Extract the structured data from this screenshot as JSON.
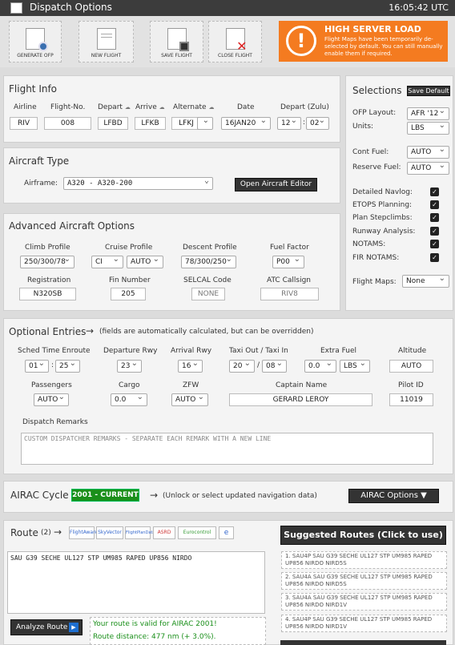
{
  "window": {
    "title": "Dispatch Options",
    "time": "16:05:42 UTC"
  },
  "toolbar": {
    "generate": "GENERATE OFP",
    "new_flight": "NEW FLIGHT",
    "save": "SAVE FLIGHT",
    "close": "CLOSE FLIGHT"
  },
  "warning": {
    "symbol": "!",
    "title": "HIGH SERVER LOAD",
    "message": "Flight Maps have been temporarily de-selected by default. You can still manually enable them if required."
  },
  "flight_info": {
    "title": "Flight Info",
    "labels": {
      "airline": "Airline",
      "flight_no": "Flight-No.",
      "depart": "Depart",
      "arrive": "Arrive",
      "alternate": "Alternate",
      "date": "Date",
      "depart_zulu": "Depart (Zulu)"
    },
    "airline": "RIV",
    "flight_no": "008",
    "depart": "LFBD",
    "arrive": "LFKB",
    "alternate": "LFKJ",
    "date": "16JAN20",
    "dep_hour": "12",
    "dep_min": "02",
    "colon": ":"
  },
  "aircraft": {
    "title": "Aircraft Type",
    "airframe_label": "Airframe:",
    "airframe": "A320 - A320-200",
    "editor_button": "Open Aircraft Editor"
  },
  "advanced": {
    "title": "Advanced Aircraft Options",
    "labels": {
      "climb": "Climb Profile",
      "cruise": "Cruise Profile",
      "descent": "Descent Profile",
      "fuel_factor": "Fuel Factor",
      "registration": "Registration",
      "fin": "Fin Number",
      "selcal": "SELCAL Code",
      "atc": "ATC Callsign"
    },
    "climb": "250/300/78",
    "cruise_mode": "CI",
    "cruise_level": "AUTO",
    "descent": "78/300/250",
    "fuel_factor": "P00",
    "registration": "N320SB",
    "fin": "205",
    "selcal": "NONE",
    "atc": "RIV8"
  },
  "selections": {
    "title": "Selections",
    "save_default": "Save Default",
    "ofp_layout_label": "OFP Layout:",
    "ofp_layout": "AFR '12",
    "units_label": "Units:",
    "units": "LBS",
    "cont_fuel_label": "Cont Fuel:",
    "cont_fuel": "AUTO",
    "reserve_fuel_label": "Reserve Fuel:",
    "reserve_fuel": "AUTO",
    "checks": [
      {
        "label": "Detailed Navlog:",
        "mark": "✓"
      },
      {
        "label": "ETOPS Planning:",
        "mark": "✓"
      },
      {
        "label": "Plan Stepclimbs:",
        "mark": "✓"
      },
      {
        "label": "Runway Analysis:",
        "mark": "✓"
      },
      {
        "label": "NOTAMS:",
        "mark": "✓"
      },
      {
        "label": "FIR NOTAMS:",
        "mark": "✓"
      }
    ],
    "flight_maps_label": "Flight Maps:",
    "flight_maps": "None"
  },
  "optional": {
    "title": "Optional Entries",
    "arrow": "→",
    "note": "(fields are automatically calculated, but can be overridden)",
    "labels": {
      "sched": "Sched Time Enroute",
      "dep_rwy": "Departure Rwy",
      "arr_rwy": "Arrival Rwy",
      "taxi": "Taxi Out / Taxi In",
      "extra_fuel": "Extra Fuel",
      "altitude": "Altitude",
      "pax": "Passengers",
      "cargo": "Cargo",
      "zfw": "ZFW",
      "captain": "Captain Name",
      "pilot_id": "Pilot ID",
      "remarks": "Dispatch Remarks"
    },
    "sched_h": "01",
    "sched_m": "25",
    "colon": ":",
    "dep_rwy": "23",
    "arr_rwy": "16",
    "taxi_out": "20",
    "slash": "/",
    "taxi_in": "08",
    "extra_fuel": "0.0",
    "extra_unit": "LBS",
    "altitude": "AUTO",
    "pax": "AUTO",
    "cargo": "0.0",
    "zfw": "AUTO",
    "captain": "GERARD LEROY",
    "pilot_id": "11019",
    "remarks_placeholder": "CUSTOM DISPATCHER REMARKS - SEPARATE EACH REMARK WITH A NEW LINE"
  },
  "airac": {
    "title": "AIRAC Cycle",
    "badge": "2001 - CURRENT",
    "arrow": "→",
    "note": "(Unlock or select updated navigation data)",
    "button": "AIRAC Options ▼"
  },
  "route": {
    "title": "Route",
    "count": "(2)",
    "arrow": "→",
    "providers": [
      "FlightAware",
      "SkyVector",
      "FlightPlanDatabase",
      "ASRD",
      "Eurocontrol",
      "e"
    ],
    "text": "SAU G39 SECHE UL127 STP UM985 RAPED UP856 NIRDO",
    "analyze": "Analyze Route",
    "analyze_icon": "▶",
    "valid": "Your route is valid for AIRAC 2001!",
    "distance": "Route distance: 477 nm (+ 3.0%).",
    "suggested_title": "Suggested Routes (Click to use)",
    "suggested": [
      "1. SAU4P SAU G39 SECHE UL127 STP UM985 RAPED UP856 NIRDO NIRD5S",
      "2. SAU4A SAU G39 SECHE UL127 STP UM985 RAPED UP856 NIRDO NIRD5S",
      "3. SAU4A SAU G39 SECHE UL127 STP UM985 RAPED UP856 NIRDO NIRD1V",
      "4. SAU4P SAU G39 SECHE UL127 STP UM985 RAPED UP856 NIRDO NIRD1V"
    ]
  }
}
